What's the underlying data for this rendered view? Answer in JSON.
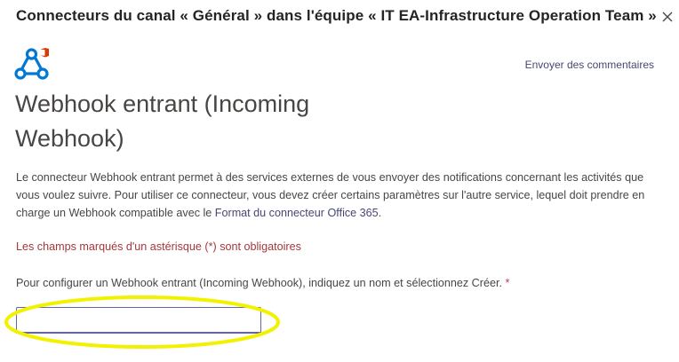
{
  "dialog": {
    "title": "Connecteurs du canal « Général » dans l'équipe « IT EA-Infrastructure Operation Team »",
    "close_icon": "close-icon"
  },
  "header": {
    "logo_icon": "webhook-office-icon",
    "feedback_link": "Envoyer des commentaires"
  },
  "connector": {
    "title": "Webhook entrant (Incoming Webhook)",
    "description_part1": "Le connecteur Webhook entrant permet à des services externes de vous envoyer des notifications concernant les activités que vous voulez suivre. Pour utiliser ce connecteur, vous devez créer certains paramètres sur l'autre service, lequel doit prendre en charge un Webhook compatible avec le ",
    "description_link": "Format du connecteur Office 365",
    "description_end": "."
  },
  "form": {
    "required_note": "Les champs marqués d'un astérisque (*) sont obligatoires",
    "config_label": "Pour configurer un Webhook entrant (Incoming Webhook), indiquez un nom et sélectionnez Créer. ",
    "required_mark": "*",
    "name_value": ""
  },
  "colors": {
    "link": "#464775",
    "required_text": "#a4373a",
    "input_border": "#6264a7",
    "highlight": "#f2f200",
    "logo_blue": "#0078d4",
    "office_red": "#d83b01"
  }
}
